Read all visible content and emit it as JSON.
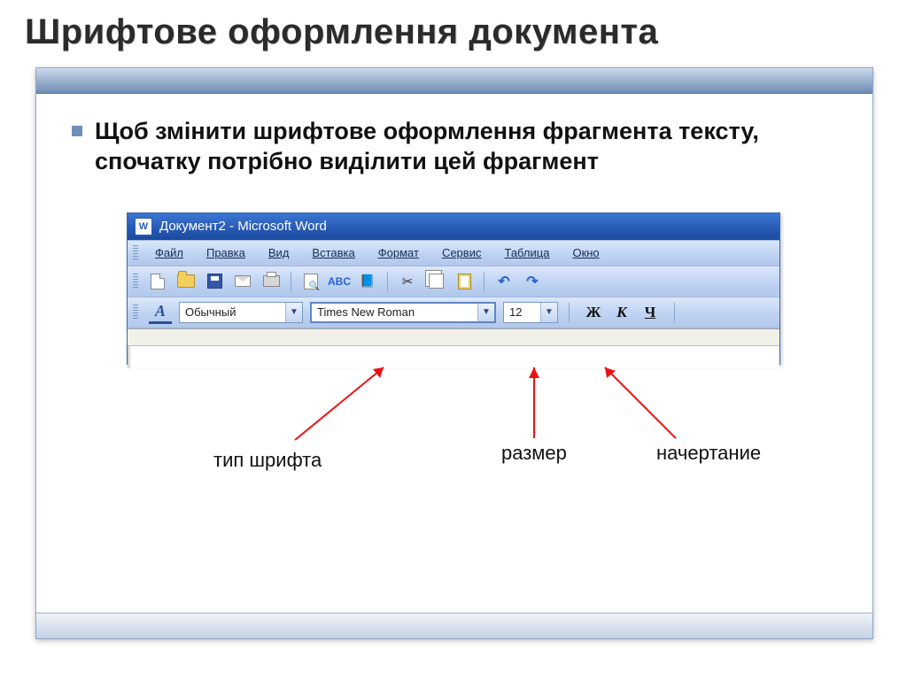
{
  "slide": {
    "title": "Шрифтове оформлення документа",
    "paragraph": "Щоб змінити шрифтове оформлення фрагмента тексту, спочатку потрібно виділити цей фрагмент"
  },
  "word": {
    "window_title": "Документ2 - Microsoft Word",
    "menu": [
      "Файл",
      "Правка",
      "Вид",
      "Вставка",
      "Формат",
      "Сервис",
      "Таблица",
      "Окно"
    ],
    "style_combo": "Обычный",
    "font_combo": "Times New Roman",
    "size_combo": "12",
    "bold": "Ж",
    "italic": "К",
    "underline": "Ч"
  },
  "callouts": {
    "font_type": "тип шрифта",
    "size": "размер",
    "style": "начертание"
  }
}
